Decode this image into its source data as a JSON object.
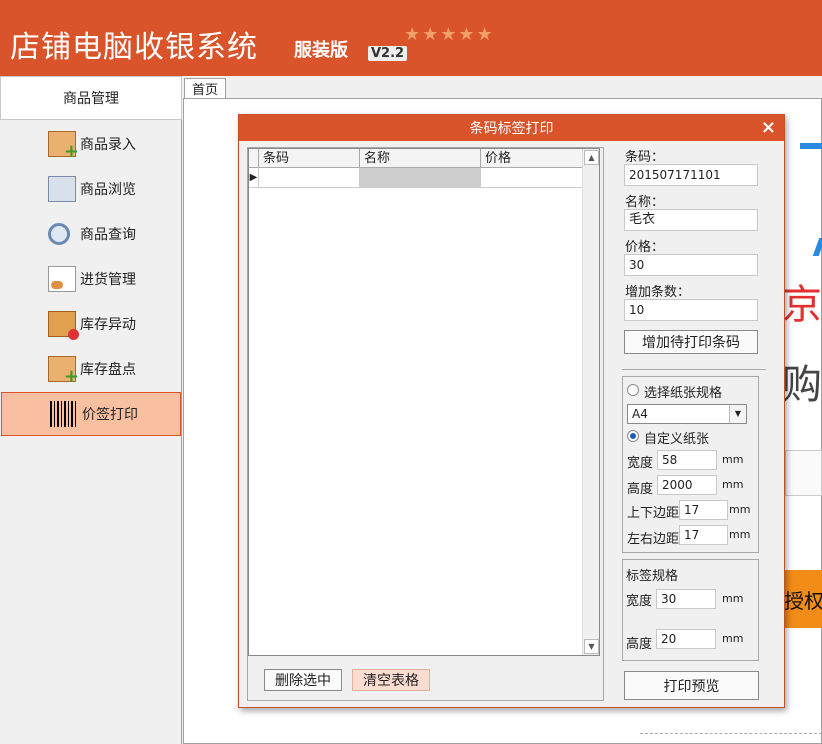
{
  "app": {
    "title": "店铺电脑收银系统",
    "edition": "服装版",
    "version": "V2.2",
    "stars": "★★★★★"
  },
  "sidebar": {
    "header": "商品管理",
    "items": [
      {
        "label": "商品录入",
        "icon": "box-add-icon"
      },
      {
        "label": "商品浏览",
        "icon": "list-icon"
      },
      {
        "label": "商品查询",
        "icon": "magnifier-icon"
      },
      {
        "label": "进货管理",
        "icon": "document-user-icon"
      },
      {
        "label": "库存异动",
        "icon": "package-alert-icon"
      },
      {
        "label": "库存盘点",
        "icon": "box-add-icon"
      },
      {
        "label": "价签打印",
        "icon": "barcode-icon",
        "active": true
      }
    ]
  },
  "tabs": [
    {
      "label": "首页"
    }
  ],
  "background": {
    "red_char": "京",
    "dark_char": "购",
    "orange_text": "授权"
  },
  "dialog": {
    "title": "条码标签打印",
    "close": "×",
    "grid": {
      "columns": [
        "条码",
        "名称",
        "价格"
      ],
      "row_marker": "▶",
      "scroll_up": "▲",
      "scroll_down": "▼"
    },
    "delete_button": "删除选中",
    "clear_button": "清空表格",
    "barcode_label": "条码：",
    "barcode_value": "201507171101",
    "name_label": "名称：",
    "name_value": "毛衣",
    "price_label": "价格：",
    "price_value": "30",
    "count_label": "增加条数：",
    "count_value": "10",
    "add_button": "增加待打印条码",
    "paper": {
      "choose_label": "选择纸张规格",
      "selected_paper": "A4",
      "arrow": "▼",
      "custom_label": "自定义纸张",
      "width_label": "宽度",
      "width_value": "58",
      "height_label": "高度",
      "height_value": "2000",
      "vmargin_label": "上下边距",
      "vmargin_value": "17",
      "hmargin_label": "左右边距",
      "hmargin_value": "17",
      "unit": "mm"
    },
    "label_spec": {
      "title": "标签规格",
      "width_label": "宽度",
      "width_value": "30",
      "height_label": "高度",
      "height_value": "20",
      "unit": "mm"
    },
    "preview_button": "打印预览"
  },
  "colors": {
    "brand": "#d9532b",
    "active_item": "#f8c0a0"
  }
}
